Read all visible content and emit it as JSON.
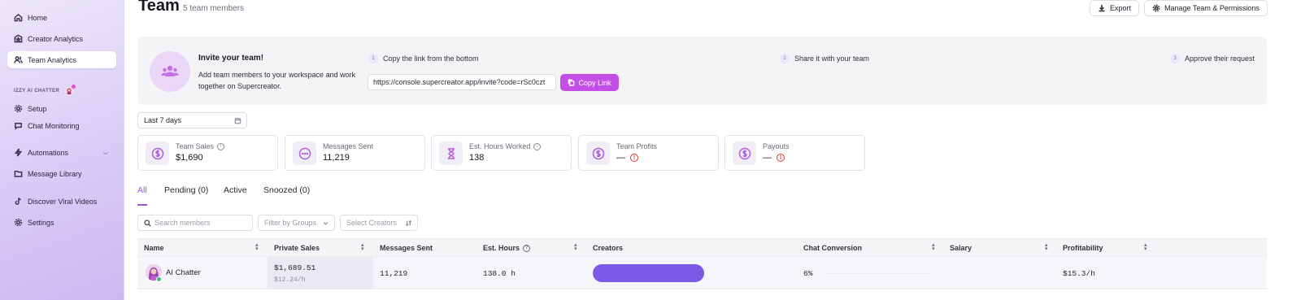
{
  "sidebar": {
    "items": [
      {
        "label": "Home",
        "icon": "home-icon"
      },
      {
        "label": "Creator Analytics",
        "icon": "star-box-icon"
      },
      {
        "label": "Team Analytics",
        "icon": "team-icon",
        "active": true
      }
    ],
    "section_label": "IZZY AI CHATTER",
    "section_items": [
      {
        "label": "Setup",
        "icon": "gear-icon"
      },
      {
        "label": "Chat Monitoring",
        "icon": "chat-icon"
      }
    ],
    "automations_label": "Automations",
    "message_library_label": "Message Library",
    "discover_label": "Discover Viral Videos",
    "settings_label": "Settings"
  },
  "header": {
    "title": "Team",
    "member_count": "5 team members",
    "export_label": "Export",
    "manage_label": "Manage Team & Permissions"
  },
  "invite": {
    "title": "Invite your team!",
    "description": "Add team members to your workspace and work together on Supercreator.",
    "steps": [
      {
        "num": "1",
        "label": "Copy the link from the bottom"
      },
      {
        "num": "2",
        "label": "Share it with your team"
      },
      {
        "num": "3",
        "label": "Approve their request"
      }
    ],
    "link_value": "https://console.supercreator.app/invite?code=rSc0czt",
    "copy_label": "Copy Link"
  },
  "date_filter": "Last 7 days",
  "stats": [
    {
      "label": "Team Sales",
      "value": "$1,690",
      "icon": "dollar-icon",
      "info": true
    },
    {
      "label": "Messages Sent",
      "value": "11,219",
      "icon": "chat-bubble-icon"
    },
    {
      "label": "Est. Hours Worked",
      "value": "138",
      "icon": "hourglass-icon",
      "info": true
    },
    {
      "label": "Team Profits",
      "value": "—",
      "icon": "dollar-icon",
      "warning": true
    },
    {
      "label": "Payouts",
      "value": "—",
      "icon": "dollar-icon",
      "warning": true
    }
  ],
  "tabs": [
    "All",
    "Pending (0)",
    "Active",
    "Snoozed (0)"
  ],
  "filters": {
    "search_placeholder": "Search members",
    "groups_placeholder": "Filter by Groups",
    "creators_placeholder": "Select Creators"
  },
  "table": {
    "columns": [
      "Name",
      "Private Sales",
      "Messages Sent",
      "Est. Hours",
      "Creators",
      "Chat Conversion",
      "Salary",
      "Profitability"
    ],
    "rows": [
      {
        "name": "AI Chatter",
        "private_sales": "$1,689.51",
        "private_sales_rate": "$12.24/h",
        "messages_sent": "11,219",
        "est_hours": "138.0 h",
        "chat_conversion": "6%",
        "profitability": "$15.3/h"
      }
    ]
  },
  "colors": {
    "accent": "#c44fe6",
    "tab_active": "#a64ee6",
    "creator_bar": "#7a5ce8",
    "warning": "#d9342b"
  }
}
